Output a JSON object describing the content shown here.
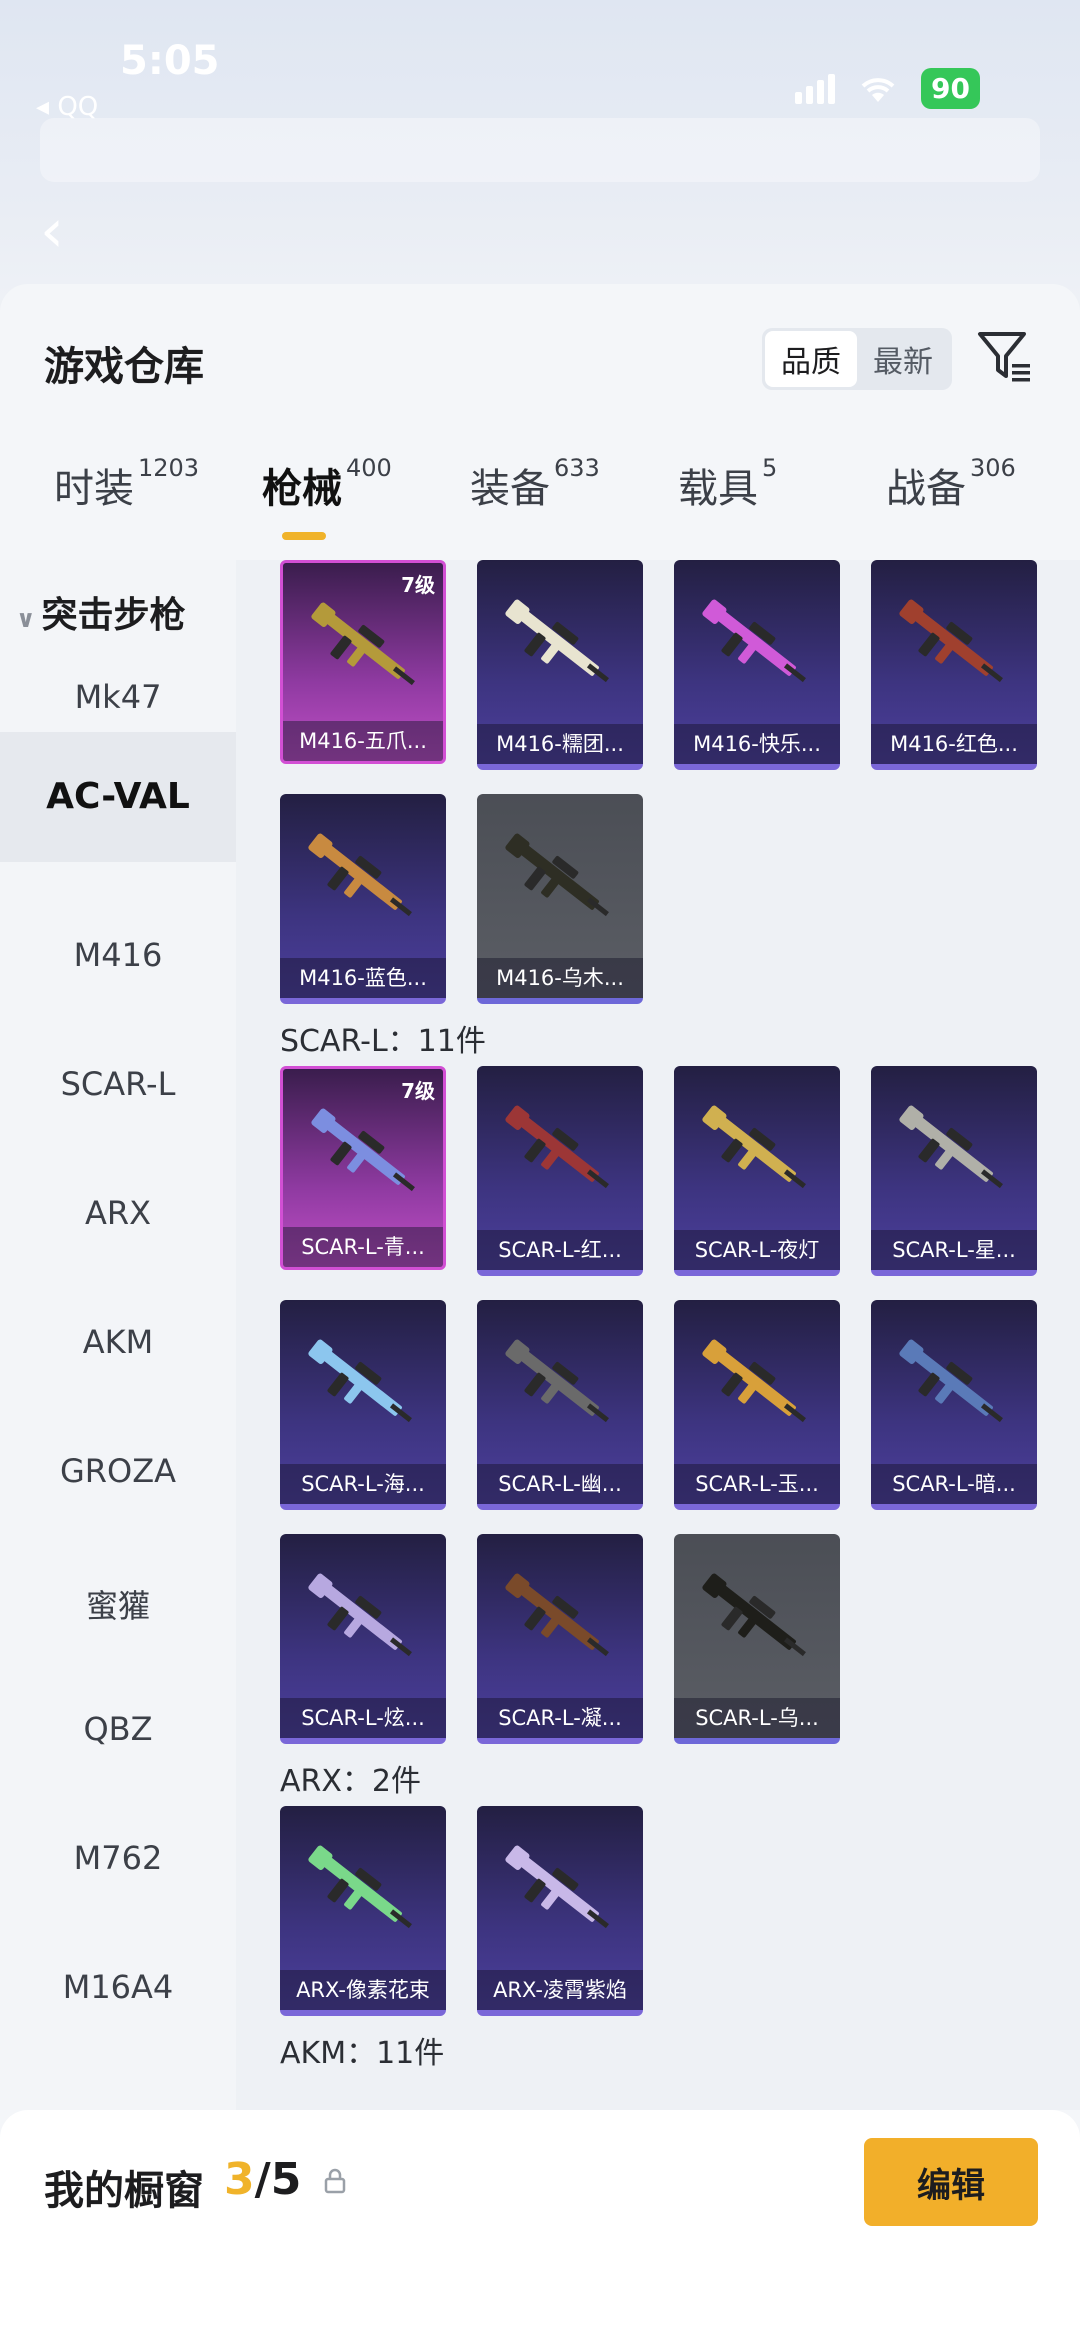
{
  "status_bar": {
    "time": "5:05",
    "back_app": "◂ QQ",
    "battery": "90"
  },
  "sheet": {
    "title": "游戏仓库",
    "sort_options": [
      "品质",
      "最新"
    ],
    "active_sort": "品质"
  },
  "tabs": [
    {
      "label": "时装",
      "count": "1203"
    },
    {
      "label": "枪械",
      "count": "400"
    },
    {
      "label": "装备",
      "count": "633"
    },
    {
      "label": "载具",
      "count": "5"
    },
    {
      "label": "战备",
      "count": "306"
    }
  ],
  "active_tab": "枪械",
  "sidebar": {
    "category": "突击步枪",
    "items": [
      "Mk47",
      "AC-VAL",
      "M416",
      "SCAR-L",
      "ARX",
      "AKM",
      "GROZA",
      "蜜獾",
      "QBZ",
      "M762",
      "M16A4"
    ],
    "active_item": "AC-VAL"
  },
  "groups": [
    {
      "title": "",
      "items": [
        {
          "name": "M416-五爪...",
          "level": "7级",
          "rarity": "pink",
          "color": "#b49a3a"
        },
        {
          "name": "M416-糯团...",
          "level": "",
          "rarity": "purple",
          "color": "#e8e4d0"
        },
        {
          "name": "M416-快乐...",
          "level": "",
          "rarity": "purple",
          "color": "#d05ad8"
        },
        {
          "name": "M416-红色...",
          "level": "",
          "rarity": "purple",
          "color": "#a0402e"
        },
        {
          "name": "M416-蓝色...",
          "level": "",
          "rarity": "purple",
          "color": "#c88a40"
        },
        {
          "name": "M416-乌木...",
          "level": "",
          "rarity": "grey",
          "color": "#2e2e24"
        }
      ]
    },
    {
      "title": "SCAR-L：11件",
      "items": [
        {
          "name": "SCAR-L-青...",
          "level": "7级",
          "rarity": "pink",
          "color": "#7c8ee0"
        },
        {
          "name": "SCAR-L-红...",
          "level": "",
          "rarity": "purple",
          "color": "#9c3636"
        },
        {
          "name": "SCAR-L-夜灯",
          "level": "",
          "rarity": "purple",
          "color": "#d0b050"
        },
        {
          "name": "SCAR-L-星...",
          "level": "",
          "rarity": "purple",
          "color": "#b0b0a8"
        },
        {
          "name": "SCAR-L-海...",
          "level": "",
          "rarity": "purple",
          "color": "#8cc6ee"
        },
        {
          "name": "SCAR-L-幽...",
          "level": "",
          "rarity": "purple",
          "color": "#6a6a6a"
        },
        {
          "name": "SCAR-L-玉...",
          "level": "",
          "rarity": "purple",
          "color": "#d8a03a"
        },
        {
          "name": "SCAR-L-暗...",
          "level": "",
          "rarity": "purple",
          "color": "#5a7ab8"
        },
        {
          "name": "SCAR-L-炫...",
          "level": "",
          "rarity": "purple",
          "color": "#b7a8e0"
        },
        {
          "name": "SCAR-L-凝...",
          "level": "",
          "rarity": "purple",
          "color": "#7a4a2a"
        },
        {
          "name": "SCAR-L-乌...",
          "level": "",
          "rarity": "grey",
          "color": "#1e1e1a"
        }
      ]
    },
    {
      "title": "ARX：2件",
      "items": [
        {
          "name": "ARX-像素花束",
          "level": "",
          "rarity": "purple",
          "color": "#7ad88a"
        },
        {
          "name": "ARX-凌霄紫焰",
          "level": "",
          "rarity": "purple",
          "color": "#c8b8e8"
        }
      ]
    },
    {
      "title": "AKM：11件",
      "items": []
    }
  ],
  "showcase": {
    "title": "我的橱窗",
    "current": "3",
    "total": "/5",
    "edit_label": "编辑"
  }
}
